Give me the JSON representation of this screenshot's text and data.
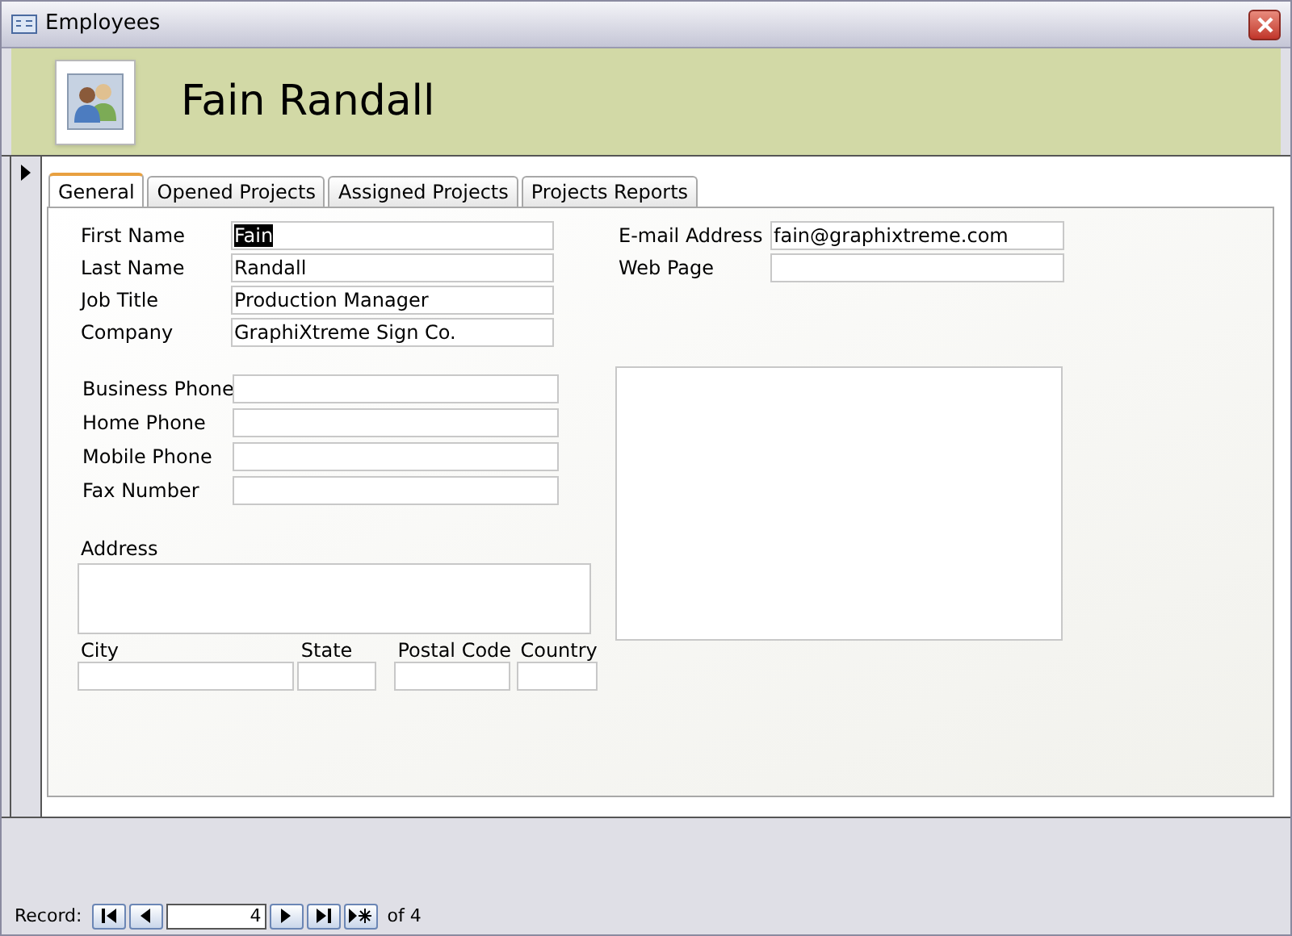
{
  "window": {
    "title": "Employees"
  },
  "header": {
    "name": "Fain Randall"
  },
  "tabs": [
    {
      "label": "General",
      "selected": true
    },
    {
      "label": "Opened Projects",
      "selected": false
    },
    {
      "label": "Assigned Projects",
      "selected": false
    },
    {
      "label": "Projects Reports",
      "selected": false
    }
  ],
  "name_fields": [
    {
      "label": "First Name",
      "value": "Fain",
      "focused": true
    },
    {
      "label": "Last Name",
      "value": "Randall",
      "focused": false
    },
    {
      "label": "Job Title",
      "value": "Production Manager",
      "focused": false
    },
    {
      "label": "Company",
      "value": "GraphiXtreme Sign Co.",
      "focused": false
    }
  ],
  "phone_fields": [
    {
      "label": "Business Phone"
    },
    {
      "label": "Home Phone"
    },
    {
      "label": "Mobile Phone"
    },
    {
      "label": "Fax Number"
    }
  ],
  "address": {
    "label": "Address"
  },
  "location_fields": [
    {
      "label": "City"
    },
    {
      "label": "State"
    },
    {
      "label": "Postal Code"
    },
    {
      "label": "Country"
    }
  ],
  "web_fields": [
    {
      "label": "E-mail Address",
      "value": "fain@graphixtreme.com"
    },
    {
      "label": "Web Page"
    }
  ],
  "navigator": {
    "label": "Record:",
    "current": "4",
    "total": "of 4"
  }
}
